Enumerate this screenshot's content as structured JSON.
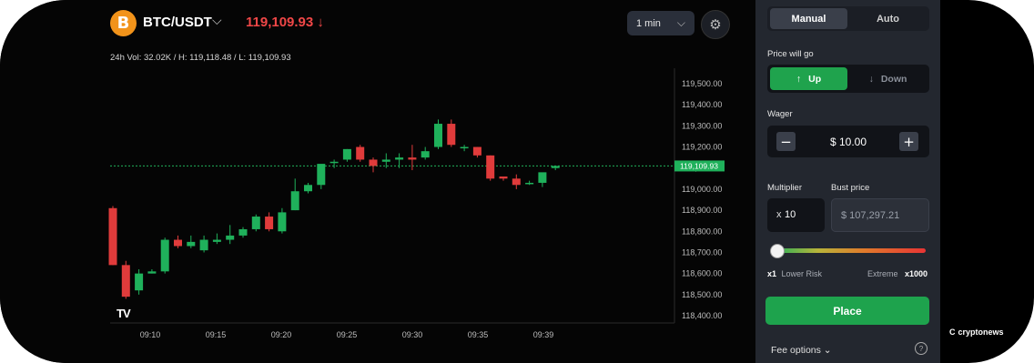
{
  "header": {
    "pair_icon": "B",
    "pair": "BTC/USDT",
    "price": "119,109.93",
    "price_arrow": "↓",
    "stats": "24h Vol: 32.02K / H: 119,118.48 / L: 119,109.93",
    "timeframe": "1 min",
    "icons": {
      "pair_dropdown": "chevron-down-icon",
      "timeframe_dropdown": "chevron-down-icon",
      "settings": "gear-icon"
    }
  },
  "chart": {
    "y_ticks": [
      "119,500.00",
      "119,400.00",
      "119,300.00",
      "119,200.00",
      "119,100.00",
      "119,000.00",
      "118,900.00",
      "118,800.00",
      "118,700.00",
      "118,600.00",
      "118,500.00",
      "118,400.00"
    ],
    "x_ticks": [
      "09:10",
      "09:15",
      "09:20",
      "09:25",
      "09:30",
      "09:35",
      "09:39"
    ],
    "current_price_label": "119,109.93",
    "logo": "TV"
  },
  "chart_data": {
    "type": "candlestick",
    "ylim": [
      118380,
      119560
    ],
    "up_color": "#1fb15b",
    "down_color": "#e03b3b",
    "current_price": 119109.93,
    "candles": [
      {
        "o": 118910,
        "h": 118920,
        "c": 118640,
        "l": 118640
      },
      {
        "o": 118640,
        "h": 118660,
        "c": 118490,
        "l": 118480
      },
      {
        "o": 118520,
        "h": 118620,
        "c": 118600,
        "l": 118500
      },
      {
        "o": 118600,
        "h": 118620,
        "c": 118610,
        "l": 118600
      },
      {
        "o": 118610,
        "h": 118770,
        "c": 118760,
        "l": 118600
      },
      {
        "o": 118760,
        "h": 118780,
        "c": 118730,
        "l": 118720
      },
      {
        "o": 118730,
        "h": 118780,
        "c": 118750,
        "l": 118720
      },
      {
        "o": 118710,
        "h": 118780,
        "c": 118760,
        "l": 118700
      },
      {
        "o": 118750,
        "h": 118790,
        "c": 118760,
        "l": 118740
      },
      {
        "o": 118760,
        "h": 118830,
        "c": 118780,
        "l": 118740
      },
      {
        "o": 118780,
        "h": 118820,
        "c": 118810,
        "l": 118770
      },
      {
        "o": 118810,
        "h": 118880,
        "c": 118870,
        "l": 118800
      },
      {
        "o": 118870,
        "h": 118890,
        "c": 118810,
        "l": 118800
      },
      {
        "o": 118800,
        "h": 118910,
        "c": 118890,
        "l": 118790
      },
      {
        "o": 118900,
        "h": 119050,
        "c": 118990,
        "l": 118900
      },
      {
        "o": 118990,
        "h": 119030,
        "c": 119020,
        "l": 118980
      },
      {
        "o": 119020,
        "h": 119110,
        "c": 119120,
        "l": 119000
      },
      {
        "o": 119130,
        "h": 119140,
        "c": 119130,
        "l": 119100
      },
      {
        "o": 119140,
        "h": 119190,
        "c": 119190,
        "l": 119130
      },
      {
        "o": 119200,
        "h": 119210,
        "c": 119140,
        "l": 119130
      },
      {
        "o": 119140,
        "h": 119150,
        "c": 119110,
        "l": 119080
      },
      {
        "o": 119130,
        "h": 119170,
        "c": 119140,
        "l": 119100
      },
      {
        "o": 119140,
        "h": 119170,
        "c": 119150,
        "l": 119100
      },
      {
        "o": 119150,
        "h": 119210,
        "c": 119140,
        "l": 119090
      },
      {
        "o": 119150,
        "h": 119200,
        "c": 119180,
        "l": 119140
      },
      {
        "o": 119200,
        "h": 119330,
        "c": 119310,
        "l": 119190
      },
      {
        "o": 119310,
        "h": 119330,
        "c": 119210,
        "l": 119200
      },
      {
        "o": 119200,
        "h": 119210,
        "c": 119200,
        "l": 119180
      },
      {
        "o": 119200,
        "h": 119200,
        "c": 119160,
        "l": 119150
      },
      {
        "o": 119160,
        "h": 119160,
        "c": 119050,
        "l": 119040
      },
      {
        "o": 119060,
        "h": 119060,
        "c": 119050,
        "l": 119040
      },
      {
        "o": 119050,
        "h": 119070,
        "c": 119020,
        "l": 119000
      },
      {
        "o": 119030,
        "h": 119040,
        "c": 119030,
        "l": 119020
      },
      {
        "o": 119030,
        "h": 119070,
        "c": 119080,
        "l": 119010
      },
      {
        "o": 119100,
        "h": 119110,
        "c": 119110,
        "l": 119090
      }
    ]
  },
  "panel": {
    "tabs": [
      "Manual",
      "Auto"
    ],
    "direction_label": "Price will go",
    "up_label": "Up",
    "up_icon": "↑",
    "down_label": "Down",
    "down_icon": "↓",
    "wager_label": "Wager",
    "wager_minus": "−",
    "wager_value": "$ 10.00",
    "wager_plus": "+",
    "multiplier_label": "Multiplier",
    "multiplier_prefix": "x",
    "multiplier_value": "10",
    "bust_label": "Bust price",
    "bust_value": "$ 107,297.21",
    "risk_min_value": "x1",
    "risk_min_label": "Lower Risk",
    "risk_max_label": "Extreme",
    "risk_max_value": "x1000",
    "multiplier_level": 0.0,
    "place_label": "Place",
    "fee_label": "Fee options",
    "fee_chevron": "⌄",
    "help_icon": "?"
  },
  "watermark": "cryptonews",
  "watermark_icon": "C"
}
